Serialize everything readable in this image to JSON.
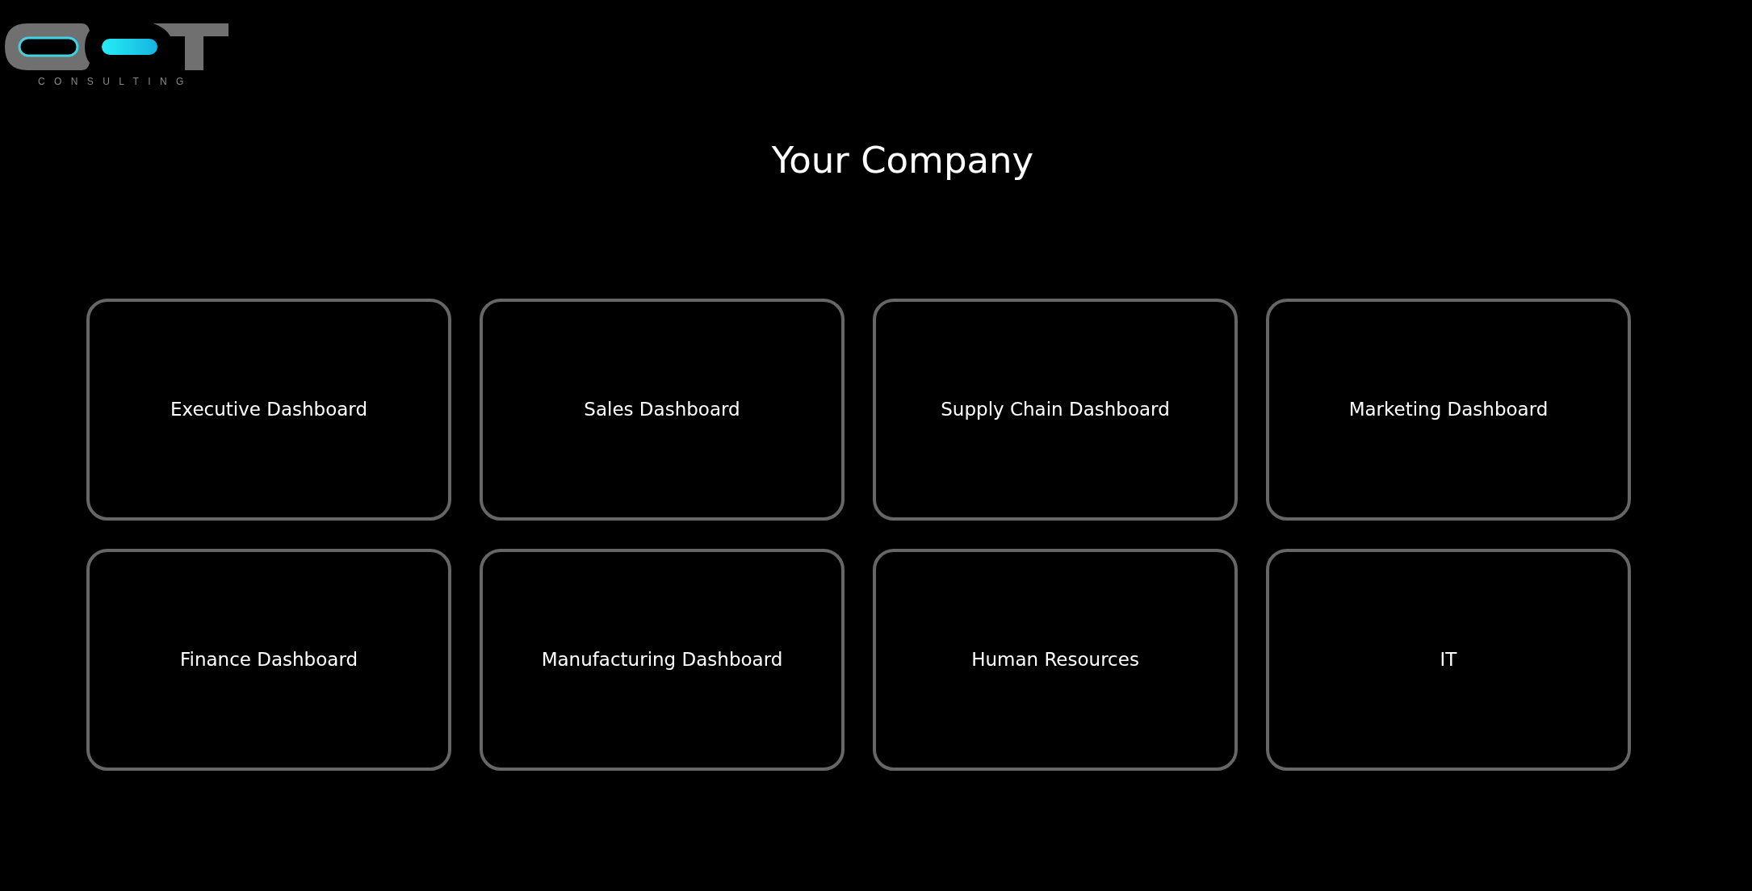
{
  "logo": {
    "tagline": "CONSULTING"
  },
  "title": "Your Company",
  "tiles": [
    {
      "label": "Executive Dashboard"
    },
    {
      "label": "Sales Dashboard"
    },
    {
      "label": "Supply Chain Dashboard"
    },
    {
      "label": "Marketing Dashboard"
    },
    {
      "label": "Finance Dashboard"
    },
    {
      "label": "Manufacturing Dashboard"
    },
    {
      "label": "Human Resources"
    },
    {
      "label": "IT"
    }
  ]
}
